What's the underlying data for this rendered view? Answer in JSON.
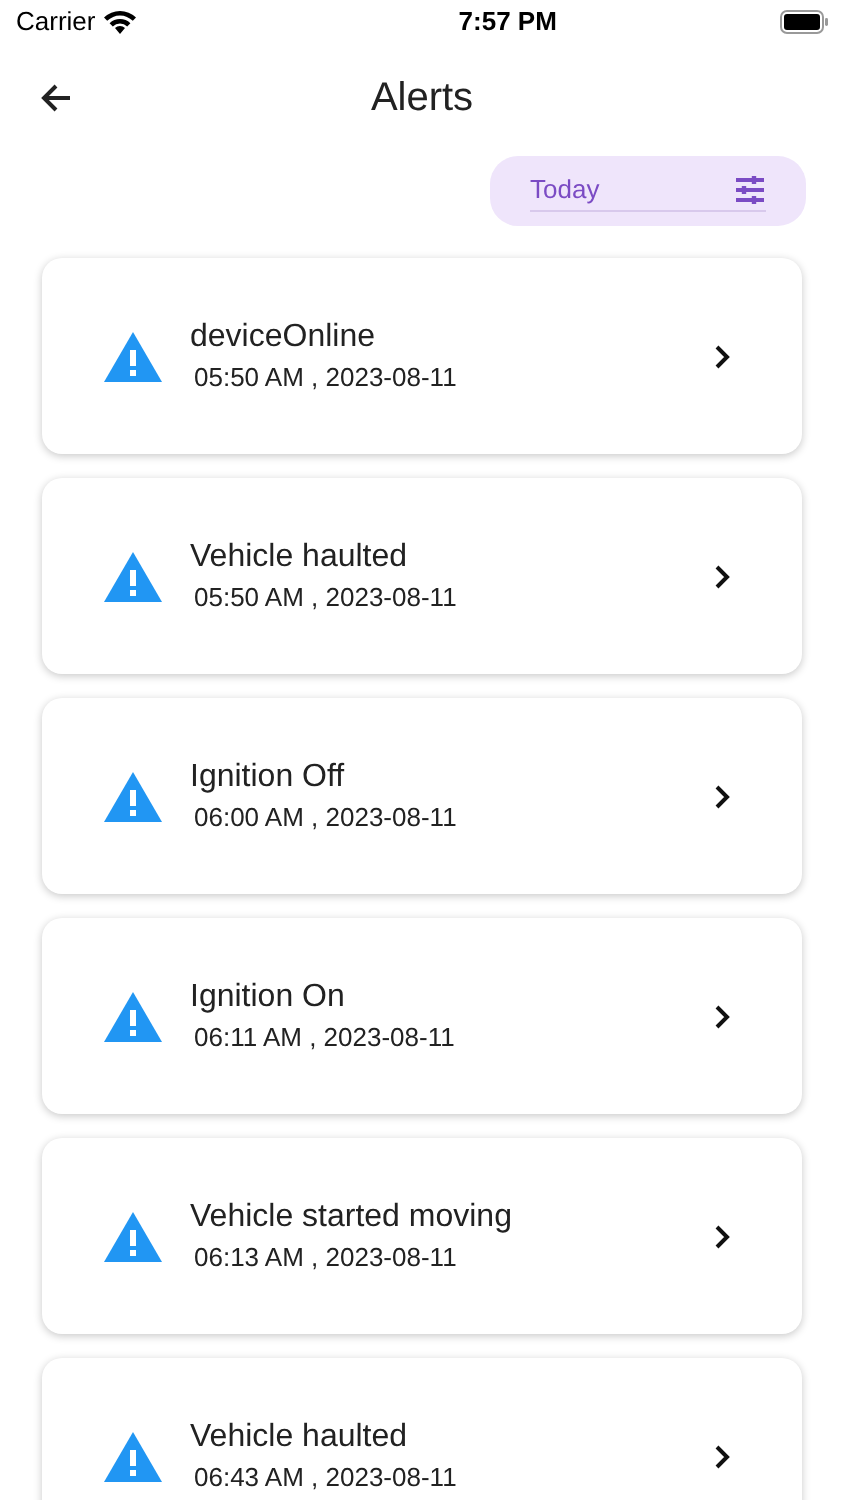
{
  "status_bar": {
    "carrier": "Carrier",
    "time": "7:57 PM"
  },
  "header": {
    "title": "Alerts"
  },
  "filter": {
    "value": "Today"
  },
  "alerts": [
    {
      "title": "deviceOnline",
      "time": "05:50 AM , 2023-08-11"
    },
    {
      "title": "Vehicle haulted",
      "time": "05:50 AM , 2023-08-11"
    },
    {
      "title": "Ignition Off",
      "time": "06:00 AM , 2023-08-11"
    },
    {
      "title": "Ignition On",
      "time": "06:11 AM , 2023-08-11"
    },
    {
      "title": "Vehicle started moving",
      "time": "06:13 AM , 2023-08-11"
    },
    {
      "title": "Vehicle haulted",
      "time": "06:43 AM , 2023-08-11"
    }
  ]
}
